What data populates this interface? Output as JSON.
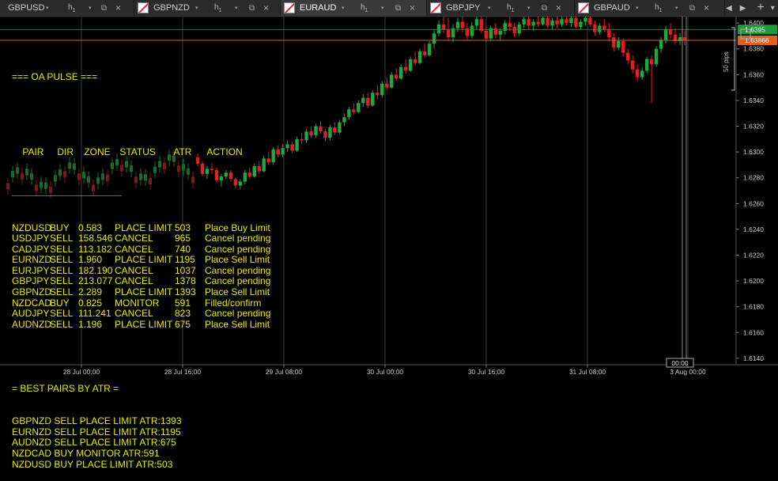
{
  "tabs": [
    {
      "symbol": "GBPUSD",
      "timeframe": "h",
      "tf_sub": "1",
      "active": false
    },
    {
      "symbol": "GBPNZD",
      "timeframe": "h",
      "tf_sub": "1",
      "active": false
    },
    {
      "symbol": "EURAUD",
      "timeframe": "h",
      "tf_sub": "1",
      "active": true
    },
    {
      "symbol": "GBPJPY",
      "timeframe": "h",
      "tf_sub": "1",
      "active": false
    },
    {
      "symbol": "GBPAUD",
      "timeframe": "h",
      "tf_sub": "1",
      "active": false
    }
  ],
  "tab_nav": {
    "prev": "◀",
    "next": "▶",
    "add": "+",
    "menu": "▾"
  },
  "overlay": {
    "title": "=== OA PULSE ===",
    "headers": [
      "PAIR",
      "DIR",
      "ZONE",
      "STATUS",
      "ATR",
      "ACTION"
    ],
    "divider": "———————————————————————",
    "rows": [
      {
        "pair": "NZDUSD",
        "dir": "BUY",
        "zone": "0.583",
        "status": "PLACE LIMIT",
        "atr": "503",
        "action": "Place Buy Limit"
      },
      {
        "pair": "USDJPY",
        "dir": "SELL",
        "zone": "158.546",
        "status": "CANCEL",
        "atr": "965",
        "action": "Cancel pending"
      },
      {
        "pair": "CADJPY",
        "dir": "SELL",
        "zone": "113.182",
        "status": "CANCEL",
        "atr": "740",
        "action": "Cancel pending"
      },
      {
        "pair": "EURNZD",
        "dir": "SELL",
        "zone": "1.960",
        "status": "PLACE LIMIT",
        "atr": "1195",
        "action": "Place Sell Limit"
      },
      {
        "pair": "EURJPY",
        "dir": "SELL",
        "zone": "182.190",
        "status": "CANCEL",
        "atr": "1037",
        "action": "Cancel pending"
      },
      {
        "pair": "GBPJPY",
        "dir": "SELL",
        "zone": "213.077",
        "status": "CANCEL",
        "atr": "1378",
        "action": "Cancel pending"
      },
      {
        "pair": "GBPNZD",
        "dir": "SELL",
        "zone": "2.289",
        "status": "PLACE LIMIT",
        "atr": "1393",
        "action": "Place Sell Limit"
      },
      {
        "pair": "NZDCAD",
        "dir": "BUY",
        "zone": "0.825",
        "status": "MONITOR",
        "atr": "591",
        "action": "Filled/confirm"
      },
      {
        "pair": "AUDJPY",
        "dir": "SELL",
        "zone": "111.241",
        "status": "CANCEL",
        "atr": "823",
        "action": "Cancel pending"
      },
      {
        "pair": "AUDNZD",
        "dir": "SELL",
        "zone": "1.196",
        "status": "PLACE LIMIT",
        "atr": "675",
        "action": "Place Sell Limit"
      }
    ],
    "best_title": "= BEST PAIRS BY ATR =",
    "best": [
      "GBPNZD SELL PLACE LIMIT ATR:1393",
      "EURNZD SELL PLACE LIMIT ATR:1195",
      "AUDNZD SELL PLACE LIMIT ATR:675",
      "NZDCAD BUY MONITOR ATR:591",
      "NZDUSD BUY PLACE LIMIT ATR:503"
    ]
  },
  "price_axis": {
    "labels": [
      "1.6400",
      "1.6380",
      "1.6360",
      "1.6340",
      "1.6320",
      "1.6300",
      "1.6280",
      "1.6260",
      "1.6240",
      "1.6220",
      "1.6200",
      "1.6180",
      "1.6160",
      "1.6140"
    ],
    "bid": "1.63866",
    "ask": "1.6395",
    "pips_label": "50 pips"
  },
  "time_axis": {
    "labels": [
      "28 Jul 00:00",
      "28 Jul 16:00",
      "29 Jul 08:00",
      "30 Jul 00:00",
      "30 Jul 16:00",
      "31 Jul 08:00",
      "3 Aug 00:00"
    ],
    "cursor": "00:00"
  },
  "colors": {
    "bull": "#1fa83b",
    "bear": "#e02020",
    "text": "#e8e800",
    "bid_line": "#e06020",
    "ask_line": "#1f8a3b",
    "grid": "#3a3a3a"
  },
  "chart_data": {
    "type": "candlestick",
    "symbol": "EURAUD",
    "timeframe": "h1",
    "candles": [
      [
        1.6296,
        1.6299,
        1.6289,
        1.6291
      ],
      [
        1.6291,
        1.6293,
        1.6281,
        1.6283
      ],
      [
        1.6283,
        1.6289,
        1.6279,
        1.6287
      ],
      [
        1.6287,
        1.6291,
        1.6283,
        1.6286
      ],
      [
        1.6286,
        1.6288,
        1.6276,
        1.6278
      ],
      [
        1.6278,
        1.6283,
        1.6273,
        1.6281
      ],
      [
        1.6281,
        1.6286,
        1.6279,
        1.6284
      ],
      [
        1.6284,
        1.6286,
        1.6277,
        1.6279
      ],
      [
        1.6279,
        1.628,
        1.6272,
        1.6274
      ],
      [
        1.6274,
        1.6279,
        1.6271,
        1.6277
      ],
      [
        1.6277,
        1.6286,
        1.6275,
        1.6284
      ],
      [
        1.6284,
        1.6288,
        1.6279,
        1.6281
      ],
      [
        1.6281,
        1.6291,
        1.628,
        1.6289
      ],
      [
        1.6289,
        1.6293,
        1.6283,
        1.6285
      ],
      [
        1.6285,
        1.6297,
        1.6284,
        1.6295
      ],
      [
        1.6295,
        1.63,
        1.629,
        1.6292
      ],
      [
        1.6292,
        1.6304,
        1.629,
        1.6302
      ],
      [
        1.6302,
        1.6305,
        1.6296,
        1.6298
      ],
      [
        1.6298,
        1.6306,
        1.6296,
        1.6303
      ],
      [
        1.6303,
        1.6309,
        1.63,
        1.6306
      ],
      [
        1.6306,
        1.6308,
        1.6299,
        1.6301
      ],
      [
        1.6301,
        1.6312,
        1.63,
        1.631
      ],
      [
        1.631,
        1.6315,
        1.6306,
        1.6309
      ],
      [
        1.6309,
        1.6318,
        1.6307,
        1.6316
      ],
      [
        1.6316,
        1.632,
        1.6311,
        1.6313
      ],
      [
        1.6313,
        1.6322,
        1.6311,
        1.632
      ],
      [
        1.632,
        1.6324,
        1.6314,
        1.6316
      ],
      [
        1.6316,
        1.6318,
        1.6308,
        1.6311
      ],
      [
        1.6311,
        1.6321,
        1.6309,
        1.6319
      ],
      [
        1.6319,
        1.6323,
        1.6313,
        1.6315
      ],
      [
        1.6315,
        1.6325,
        1.6314,
        1.6323
      ],
      [
        1.6323,
        1.633,
        1.632,
        1.6327
      ],
      [
        1.6327,
        1.6335,
        1.6325,
        1.6333
      ],
      [
        1.6333,
        1.6338,
        1.6329,
        1.6331
      ],
      [
        1.6331,
        1.634,
        1.633,
        1.6338
      ],
      [
        1.6338,
        1.6345,
        1.6335,
        1.6342
      ],
      [
        1.6342,
        1.6346,
        1.6334,
        1.6336
      ],
      [
        1.6336,
        1.6348,
        1.6335,
        1.6346
      ],
      [
        1.6346,
        1.6352,
        1.6341,
        1.6344
      ],
      [
        1.6344,
        1.6355,
        1.6342,
        1.6353
      ],
      [
        1.6353,
        1.6358,
        1.6348,
        1.635
      ],
      [
        1.635,
        1.6362,
        1.6349,
        1.636
      ],
      [
        1.636,
        1.6365,
        1.6355,
        1.6357
      ],
      [
        1.6357,
        1.6368,
        1.6356,
        1.6366
      ],
      [
        1.6366,
        1.6372,
        1.6361,
        1.6363
      ],
      [
        1.6363,
        1.6374,
        1.6362,
        1.6372
      ],
      [
        1.6372,
        1.6378,
        1.6367,
        1.6369
      ],
      [
        1.6369,
        1.638,
        1.6368,
        1.6378
      ],
      [
        1.6378,
        1.6384,
        1.6373,
        1.6375
      ],
      [
        1.6375,
        1.6386,
        1.6374,
        1.6384
      ],
      [
        1.6384,
        1.6395,
        1.638,
        1.6392
      ],
      [
        1.6392,
        1.6402,
        1.639,
        1.6399
      ],
      [
        1.6399,
        1.6405,
        1.6392,
        1.6395
      ],
      [
        1.6395,
        1.6404,
        1.6386,
        1.6389
      ],
      [
        1.6389,
        1.6399,
        1.6385,
        1.6396
      ],
      [
        1.6396,
        1.6404,
        1.6393,
        1.6401
      ],
      [
        1.6401,
        1.6405,
        1.6393,
        1.6396
      ],
      [
        1.6396,
        1.64,
        1.6387,
        1.639
      ],
      [
        1.639,
        1.6401,
        1.6388,
        1.6398
      ],
      [
        1.6398,
        1.6405,
        1.6395,
        1.6403
      ],
      [
        1.6403,
        1.6406,
        1.6392,
        1.6394
      ],
      [
        1.6394,
        1.6398,
        1.6385,
        1.6388
      ],
      [
        1.6388,
        1.6398,
        1.6386,
        1.6396
      ],
      [
        1.6396,
        1.64,
        1.6388,
        1.6391
      ],
      [
        1.6391,
        1.6396,
        1.6386,
        1.6394
      ],
      [
        1.6394,
        1.6402,
        1.6391,
        1.64
      ],
      [
        1.64,
        1.6405,
        1.6394,
        1.6397
      ],
      [
        1.6397,
        1.64,
        1.6389,
        1.6392
      ],
      [
        1.6392,
        1.6401,
        1.639,
        1.6399
      ],
      [
        1.6399,
        1.6405,
        1.6396,
        1.6403
      ],
      [
        1.6403,
        1.6406,
        1.6395,
        1.6398
      ],
      [
        1.6398,
        1.6403,
        1.6394,
        1.6401
      ],
      [
        1.6401,
        1.6406,
        1.6397,
        1.6399
      ],
      [
        1.6399,
        1.6406,
        1.6398,
        1.6404
      ],
      [
        1.6404,
        1.6406,
        1.6396,
        1.6398
      ],
      [
        1.6398,
        1.6404,
        1.6395,
        1.6402
      ],
      [
        1.6402,
        1.6406,
        1.6396,
        1.6399
      ],
      [
        1.6399,
        1.6405,
        1.6397,
        1.6403
      ],
      [
        1.6403,
        1.6406,
        1.6398,
        1.64
      ],
      [
        1.64,
        1.6405,
        1.6397,
        1.6404
      ],
      [
        1.6404,
        1.6406,
        1.6396,
        1.6397
      ],
      [
        1.6397,
        1.6403,
        1.6395,
        1.6401
      ],
      [
        1.6401,
        1.6406,
        1.6398,
        1.6404
      ],
      [
        1.6404,
        1.6406,
        1.6397,
        1.6399
      ],
      [
        1.6399,
        1.6402,
        1.639,
        1.6393
      ],
      [
        1.6393,
        1.64,
        1.6391,
        1.6398
      ],
      [
        1.6398,
        1.6403,
        1.6393,
        1.6395
      ],
      [
        1.6395,
        1.64,
        1.6386,
        1.6389
      ],
      [
        1.6389,
        1.6392,
        1.6378,
        1.6381
      ],
      [
        1.6381,
        1.6389,
        1.6379,
        1.6386
      ],
      [
        1.6386,
        1.6388,
        1.6374,
        1.6377
      ],
      [
        1.6377,
        1.638,
        1.6368,
        1.6371
      ],
      [
        1.6371,
        1.6375,
        1.6361,
        1.6364
      ],
      [
        1.6364,
        1.6368,
        1.6355,
        1.6358
      ],
      [
        1.6358,
        1.6366,
        1.6356,
        1.6363
      ],
      [
        1.6363,
        1.6374,
        1.6361,
        1.6372
      ],
      [
        1.6372,
        1.6375,
        1.6338,
        1.6368
      ],
      [
        1.6368,
        1.6382,
        1.6366,
        1.638
      ],
      [
        1.638,
        1.6389,
        1.6377,
        1.6387
      ],
      [
        1.6387,
        1.6398,
        1.6384,
        1.6395
      ],
      [
        1.6395,
        1.64,
        1.6388,
        1.6391
      ],
      [
        1.6391,
        1.6396,
        1.6383,
        1.6386
      ],
      [
        1.6386,
        1.6392,
        1.6383,
        1.6389
      ],
      [
        1.6389,
        1.6394,
        1.6383,
        1.6387
      ]
    ],
    "ylim": [
      1.6135,
      1.6405
    ],
    "x_ticks": [
      "28 Jul 00:00",
      "28 Jul 16:00",
      "29 Jul 08:00",
      "30 Jul 00:00",
      "30 Jul 16:00",
      "31 Jul 08:00",
      "3 Aug 00:00"
    ],
    "y_ticks": [
      "1.6400",
      "1.6380",
      "1.6360",
      "1.6340",
      "1.6320",
      "1.6300",
      "1.6280",
      "1.6260",
      "1.6240",
      "1.6220",
      "1.6200",
      "1.6180",
      "1.6160",
      "1.6140"
    ],
    "bid": 1.63866,
    "ask": 1.6395,
    "grid": true
  }
}
